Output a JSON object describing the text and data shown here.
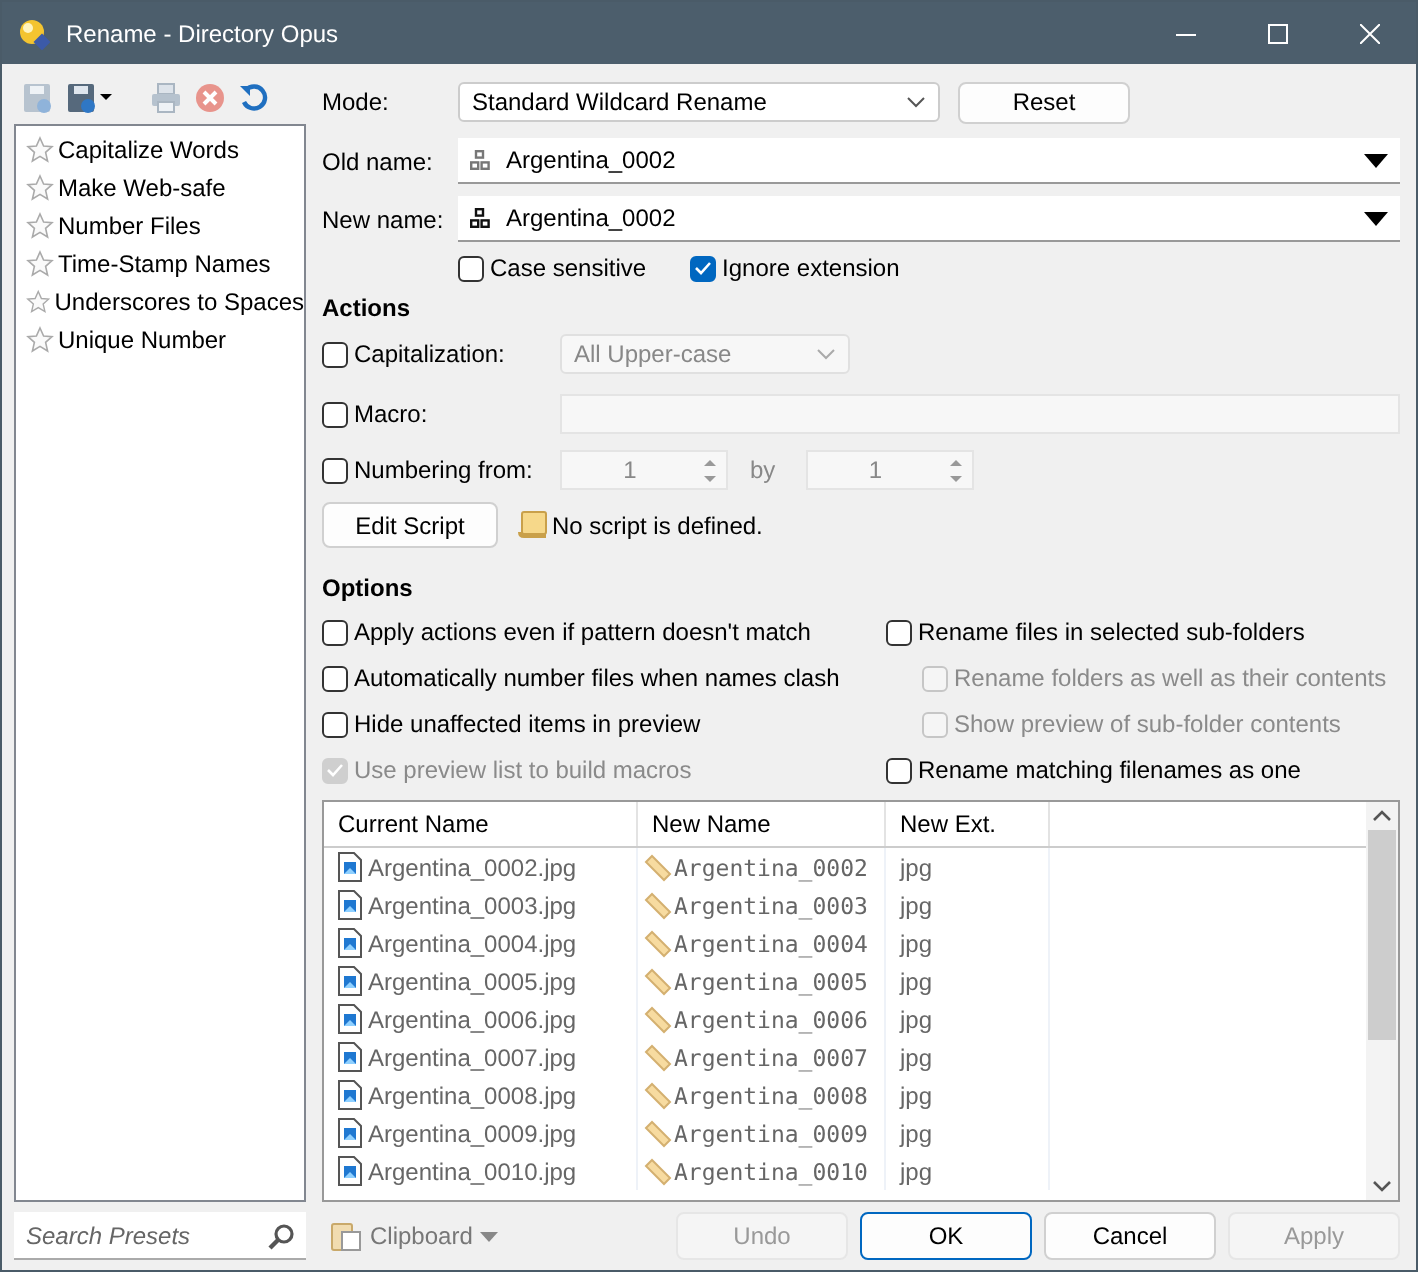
{
  "window": {
    "title": "Rename - Directory Opus"
  },
  "presets": [
    {
      "label": "Capitalize Words"
    },
    {
      "label": "Make Web-safe"
    },
    {
      "label": "Number Files"
    },
    {
      "label": "Time-Stamp Names"
    },
    {
      "label": "Underscores to Spaces"
    },
    {
      "label": "Unique Number"
    }
  ],
  "search": {
    "placeholder": "Search Presets"
  },
  "mode": {
    "label": "Mode:",
    "value": "Standard Wildcard Rename",
    "reset": "Reset"
  },
  "old_name": {
    "label": "Old name:",
    "value": "Argentina_0002"
  },
  "new_name": {
    "label": "New name:",
    "value": "Argentina_0002"
  },
  "match_options": [
    {
      "label": "Case sensitive",
      "checked": false
    },
    {
      "label": "Ignore extension",
      "checked": true
    }
  ],
  "actions": {
    "heading": "Actions",
    "capitalization": {
      "label": "Capitalization:",
      "checked": false,
      "value": "All Upper-case"
    },
    "macro": {
      "label": "Macro:",
      "checked": false
    },
    "numbering": {
      "label": "Numbering from:",
      "checked": false,
      "from": "1",
      "by_label": "by",
      "by": "1"
    },
    "edit_script": "Edit Script",
    "script_status": "No script is defined."
  },
  "options": {
    "heading": "Options",
    "left": [
      {
        "label": "Apply actions even if pattern doesn't match",
        "checked": false,
        "disabled": false
      },
      {
        "label": "Automatically number files when names clash",
        "checked": false,
        "disabled": false
      },
      {
        "label": "Hide unaffected items in preview",
        "checked": false,
        "disabled": false
      },
      {
        "label": "Use preview list to build macros",
        "checked": true,
        "disabled": true
      }
    ],
    "right": [
      {
        "label": "Rename files in selected sub-folders",
        "checked": false,
        "disabled": false,
        "children": [
          {
            "label": "Rename folders as well as their contents",
            "checked": false,
            "disabled": true
          },
          {
            "label": "Show preview of sub-folder contents",
            "checked": false,
            "disabled": true
          }
        ]
      },
      {
        "label": "Rename matching filenames as one",
        "checked": false,
        "disabled": false
      }
    ]
  },
  "preview": {
    "columns": [
      "Current Name",
      "New Name",
      "New Ext."
    ],
    "rows": [
      {
        "current": "Argentina_0002.jpg",
        "new_name": "Argentina_0002",
        "new_ext": "jpg"
      },
      {
        "current": "Argentina_0003.jpg",
        "new_name": "Argentina_0003",
        "new_ext": "jpg"
      },
      {
        "current": "Argentina_0004.jpg",
        "new_name": "Argentina_0004",
        "new_ext": "jpg"
      },
      {
        "current": "Argentina_0005.jpg",
        "new_name": "Argentina_0005",
        "new_ext": "jpg"
      },
      {
        "current": "Argentina_0006.jpg",
        "new_name": "Argentina_0006",
        "new_ext": "jpg"
      },
      {
        "current": "Argentina_0007.jpg",
        "new_name": "Argentina_0007",
        "new_ext": "jpg"
      },
      {
        "current": "Argentina_0008.jpg",
        "new_name": "Argentina_0008",
        "new_ext": "jpg"
      },
      {
        "current": "Argentina_0009.jpg",
        "new_name": "Argentina_0009",
        "new_ext": "jpg"
      },
      {
        "current": "Argentina_0010.jpg",
        "new_name": "Argentina_0010",
        "new_ext": "jpg"
      }
    ]
  },
  "clipboard": "Clipboard",
  "buttons": [
    {
      "label": "Undo",
      "disabled": true,
      "default": false
    },
    {
      "label": "OK",
      "disabled": false,
      "default": true
    },
    {
      "label": "Cancel",
      "disabled": false,
      "default": false
    },
    {
      "label": "Apply",
      "disabled": true,
      "default": false
    }
  ]
}
